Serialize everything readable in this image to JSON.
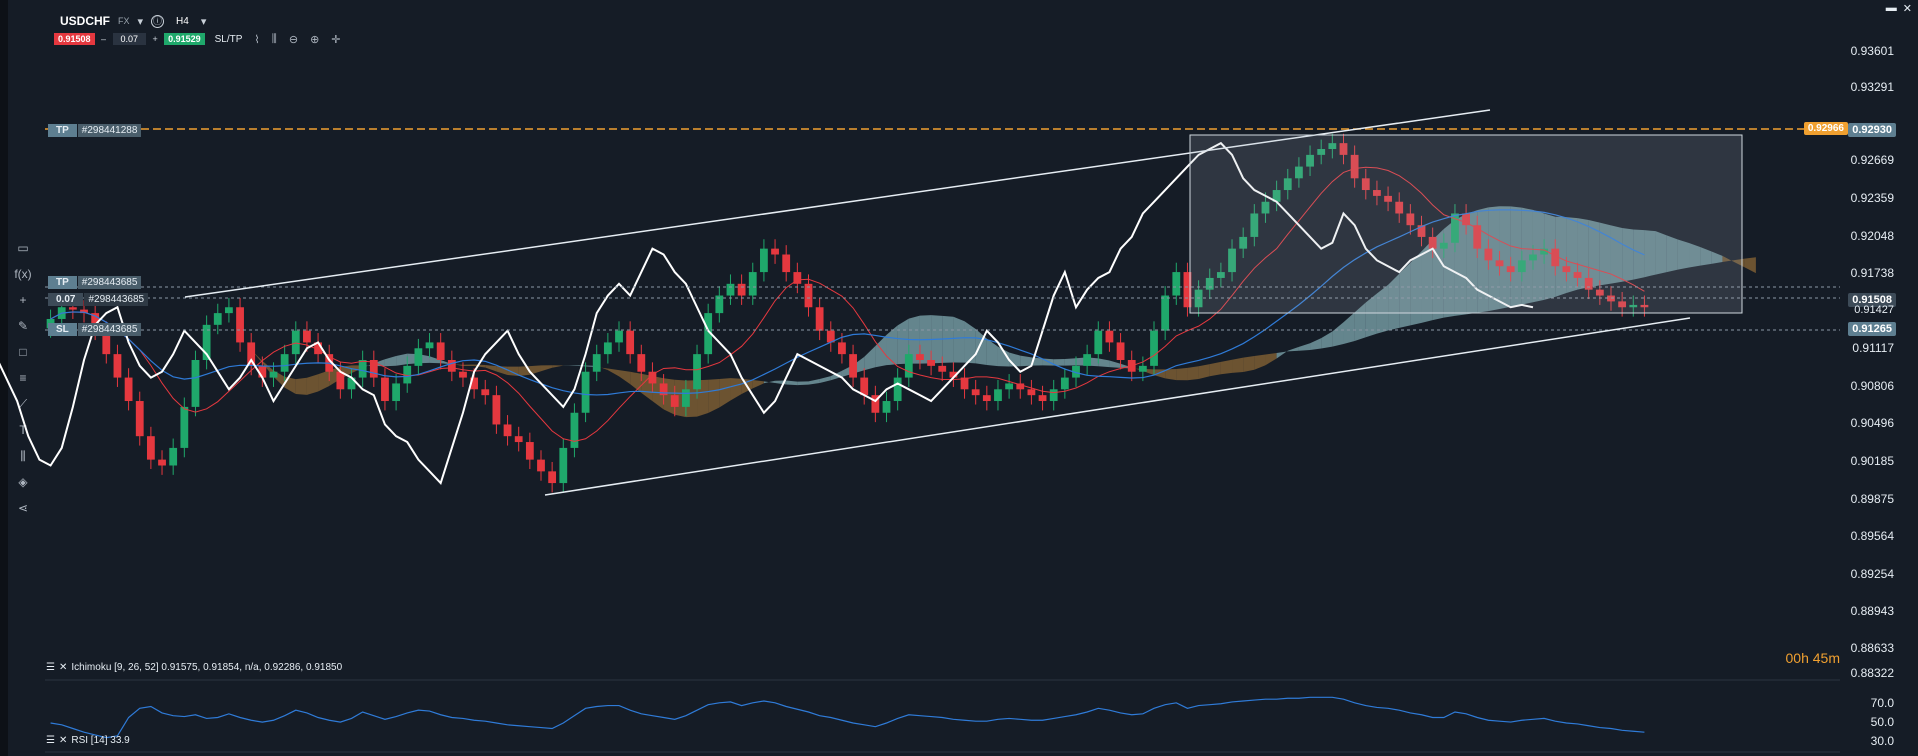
{
  "header": {
    "symbol": "USDCHF",
    "market": "FX",
    "timeframe": "H4",
    "info_icon": "ⓘ"
  },
  "trade": {
    "sell_price": "0.91508",
    "quantity": "0.07",
    "buy_price": "0.91529",
    "sltp_label": "SL/TP",
    "minus": "–",
    "plus": "+"
  },
  "icons": {
    "line-chart-icon": "⌇",
    "candles-icon": "⫼",
    "zoom-out-icon": "⊖",
    "zoom-in-icon": "⊕",
    "crosshair-icon": "✛"
  },
  "price_axis": {
    "labels": [
      "0.93601",
      "0.93291",
      "0.92669",
      "0.92359",
      "0.92048",
      "0.91738",
      "0.91117",
      "0.90806",
      "0.90496",
      "0.90185",
      "0.89875",
      "0.89564",
      "0.89254",
      "0.88943",
      "0.88633",
      "0.88322"
    ],
    "tp_tag": "0.92930",
    "tp_order_price": "0.92966",
    "current_tag": "0.91508",
    "sl_tag": "0.91265",
    "mid_label": "0.91427"
  },
  "orders": [
    {
      "type": "TP",
      "id": "#298441288"
    },
    {
      "type": "TP",
      "id": "#298443685"
    },
    {
      "type": "0.07",
      "id": "#298443685"
    },
    {
      "type": "SL",
      "id": "#298443685"
    }
  ],
  "countdown": {
    "h": "00h",
    "m": "45m"
  },
  "ichimoku": {
    "label": "Ichimoku [9, 26, 52] 0.91575, 0.91854, n/a, 0.92286, 0.91850"
  },
  "rsi": {
    "label": "RSI [14] 33.9",
    "levels": [
      "70.0",
      "50.0",
      "30.0"
    ]
  },
  "colors": {
    "bull": "#1fa86b",
    "bear": "#e5383f",
    "tenkan": "#e5383f",
    "kijun": "#2f7bd8",
    "cloud_up": "#7fa8b0",
    "cloud_down": "#8a6536",
    "lagging": "#ffffff",
    "tp_line": "#f0a030",
    "rsi": "#2f7bd8"
  },
  "chart_data": {
    "type": "candlestick",
    "symbol": "USDCHF",
    "timeframe": "H4",
    "ylim": [
      0.8832,
      0.9378
    ],
    "close": [
      0.914,
      0.915,
      0.9148,
      0.9145,
      0.913,
      0.911,
      0.909,
      0.907,
      0.904,
      0.902,
      0.9015,
      0.903,
      0.9065,
      0.9105,
      0.9135,
      0.9145,
      0.915,
      0.912,
      0.91,
      0.909,
      0.9095,
      0.911,
      0.913,
      0.912,
      0.911,
      0.9095,
      0.908,
      0.909,
      0.9105,
      0.909,
      0.907,
      0.9085,
      0.91,
      0.9115,
      0.912,
      0.9105,
      0.9095,
      0.909,
      0.908,
      0.9075,
      0.905,
      0.904,
      0.9035,
      0.902,
      0.901,
      0.9,
      0.903,
      0.906,
      0.9095,
      0.911,
      0.912,
      0.913,
      0.911,
      0.9095,
      0.9085,
      0.9075,
      0.9065,
      0.908,
      0.911,
      0.9145,
      0.916,
      0.917,
      0.916,
      0.918,
      0.92,
      0.9195,
      0.918,
      0.917,
      0.915,
      0.913,
      0.912,
      0.911,
      0.909,
      0.9075,
      0.906,
      0.907,
      0.909,
      0.911,
      0.9105,
      0.91,
      0.9095,
      0.909,
      0.908,
      0.9075,
      0.907,
      0.908,
      0.9085,
      0.908,
      0.9075,
      0.907,
      0.908,
      0.909,
      0.91,
      0.911,
      0.913,
      0.912,
      0.9105,
      0.9095,
      0.91,
      0.913,
      0.916,
      0.918,
      0.915,
      0.9165,
      0.9175,
      0.918,
      0.92,
      0.921,
      0.923,
      0.924,
      0.925,
      0.926,
      0.927,
      0.928,
      0.9285,
      0.929,
      0.928,
      0.926,
      0.925,
      0.9245,
      0.924,
      0.923,
      0.922,
      0.921,
      0.92,
      0.9205,
      0.923,
      0.922,
      0.92,
      0.919,
      0.9185,
      0.918,
      0.919,
      0.9195,
      0.92,
      0.9185,
      0.918,
      0.9175,
      0.9165,
      0.916,
      0.9155,
      0.915,
      0.9152,
      0.915
    ],
    "rsi": [
      44,
      42,
      38,
      34,
      31,
      28,
      30,
      50,
      60,
      62,
      55,
      52,
      51,
      53,
      49,
      50,
      54,
      50,
      47,
      45,
      47,
      52,
      58,
      55,
      50,
      47,
      45,
      49,
      56,
      52,
      48,
      51,
      55,
      58,
      57,
      53,
      50,
      49,
      47,
      46,
      44,
      42,
      41,
      40,
      39,
      38,
      44,
      52,
      60,
      62,
      63,
      63,
      58,
      54,
      52,
      50,
      48,
      52,
      58,
      64,
      66,
      67,
      63,
      66,
      68,
      66,
      62,
      59,
      56,
      52,
      50,
      47,
      44,
      42,
      40,
      44,
      49,
      53,
      52,
      51,
      50,
      48,
      47,
      46,
      46,
      48,
      49,
      48,
      47,
      47,
      49,
      51,
      53,
      56,
      60,
      58,
      55,
      53,
      54,
      60,
      64,
      66,
      60,
      63,
      64,
      65,
      67,
      68,
      69,
      70,
      70,
      71,
      71,
      72,
      72,
      72,
      70,
      66,
      63,
      61,
      60,
      58,
      55,
      53,
      50,
      50,
      56,
      54,
      50,
      47,
      46,
      45,
      47,
      48,
      49,
      46,
      44,
      43,
      41,
      39,
      38,
      36,
      35,
      34
    ]
  }
}
